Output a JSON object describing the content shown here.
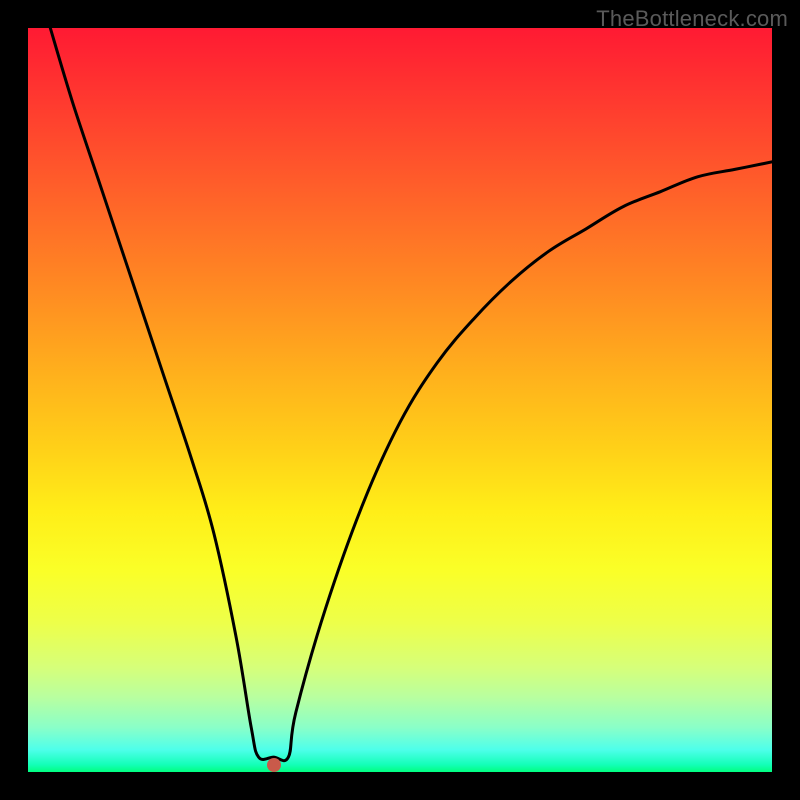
{
  "watermark": "TheBottleneck.com",
  "chart_data": {
    "type": "line",
    "title": "",
    "xlabel": "",
    "ylabel": "",
    "xlim": [
      0,
      100
    ],
    "ylim": [
      0,
      100
    ],
    "series": [
      {
        "name": "bottleneck-curve",
        "x": [
          3,
          6,
          10,
          14,
          18,
          22,
          25,
          28,
          30,
          31,
          33,
          35,
          36,
          40,
          45,
          50,
          55,
          60,
          65,
          70,
          75,
          80,
          85,
          90,
          95,
          100
        ],
        "values": [
          100,
          90,
          78,
          66,
          54,
          42,
          32,
          18,
          6,
          2,
          2,
          2,
          8,
          22,
          36,
          47,
          55,
          61,
          66,
          70,
          73,
          76,
          78,
          80,
          81,
          82
        ]
      }
    ],
    "marker": {
      "x": 33,
      "y": 1
    },
    "gradient_stops": [
      {
        "pct": 0,
        "color": "#ff1a33"
      },
      {
        "pct": 25,
        "color": "#ff6a28"
      },
      {
        "pct": 50,
        "color": "#ffc41a"
      },
      {
        "pct": 70,
        "color": "#f6ff30"
      },
      {
        "pct": 90,
        "color": "#b8ffa0"
      },
      {
        "pct": 100,
        "color": "#00ff80"
      }
    ]
  }
}
